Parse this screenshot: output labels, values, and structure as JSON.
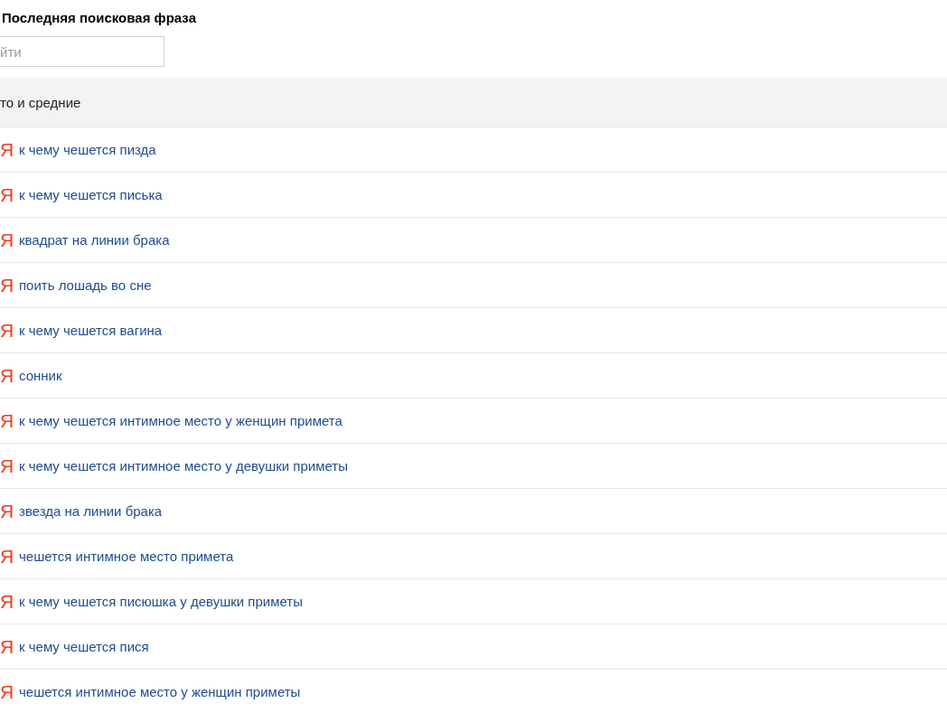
{
  "title": "Последняя поисковая фраза",
  "search": {
    "placeholder": "йти"
  },
  "table": {
    "header": "то и средние",
    "rows": [
      {
        "engine": "Я",
        "phrase": "к чему чешется пизда"
      },
      {
        "engine": "Я",
        "phrase": "к чему чешется писька"
      },
      {
        "engine": "Я",
        "phrase": "квадрат на линии брака"
      },
      {
        "engine": "Я",
        "phrase": "поить лошадь во сне"
      },
      {
        "engine": "Я",
        "phrase": "к чему чешется вагина"
      },
      {
        "engine": "Я",
        "phrase": "сонник"
      },
      {
        "engine": "Я",
        "phrase": "к чему чешется интимное место у женщин примета"
      },
      {
        "engine": "Я",
        "phrase": "к чему чешется интимное место у девушки приметы"
      },
      {
        "engine": "Я",
        "phrase": "звезда на линии брака"
      },
      {
        "engine": "Я",
        "phrase": "чешется интимное место примета"
      },
      {
        "engine": "Я",
        "phrase": "к чему чешется писюшка у девушки приметы"
      },
      {
        "engine": "Я",
        "phrase": "к чему чешется пися"
      },
      {
        "engine": "Я",
        "phrase": "чешется интимное место у женщин приметы"
      }
    ]
  }
}
